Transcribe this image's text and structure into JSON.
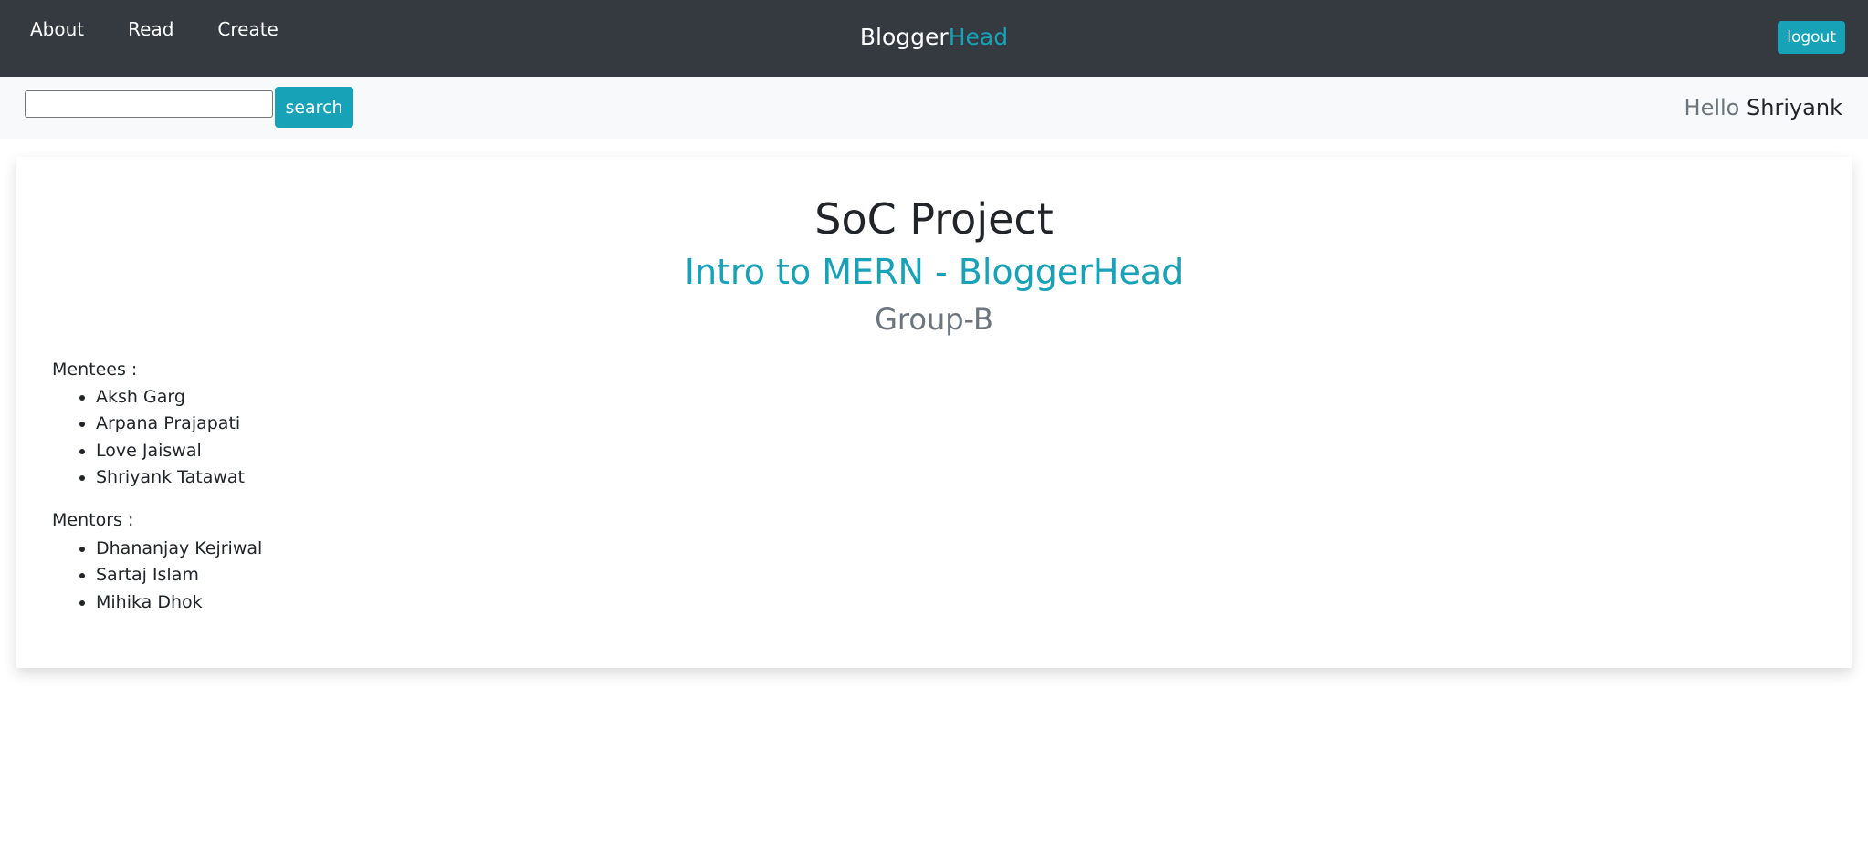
{
  "navbar": {
    "links": [
      "About",
      "Read",
      "Create"
    ],
    "brand_part1": "Blogger",
    "brand_part2": "Head",
    "logout_label": "logout"
  },
  "search": {
    "placeholder": "",
    "value": "",
    "button_label": "search"
  },
  "greeting": {
    "hello": "Hello",
    "name": "Shriyank"
  },
  "card": {
    "title": "SoC Project",
    "subtitle": "Intro to MERN - BloggerHead",
    "group": "Group-B",
    "mentees_label": "Mentees :",
    "mentees": [
      "Aksh Garg",
      "Arpana Prajapati",
      "Love Jaiswal",
      "Shriyank Tatawat"
    ],
    "mentors_label": "Mentors :",
    "mentors": [
      "Dhananjay Kejriwal",
      "Sartaj Islam",
      "Mihika Dhok"
    ]
  },
  "colors": {
    "navbar_bg": "#343a40",
    "accent": "#17a2b8",
    "subbar_bg": "#f8f9fa",
    "muted": "#6c757d"
  }
}
